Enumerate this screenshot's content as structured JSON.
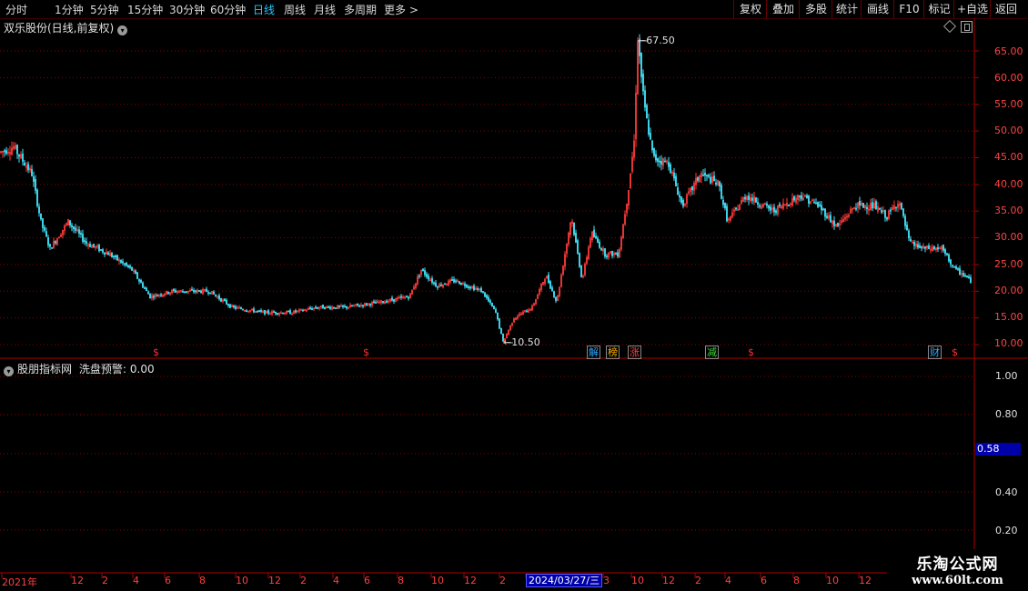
{
  "toolbar": {
    "periods": [
      "分时",
      "1分钟",
      "5分钟",
      "15分钟",
      "30分钟",
      "60分钟",
      "日线",
      "周线",
      "月线",
      "多周期",
      "更多 >"
    ],
    "active_period": "日线",
    "actions": [
      "复权",
      "叠加",
      "多股",
      "统计",
      "画线",
      "F10",
      "标记",
      "+自选",
      "返回"
    ]
  },
  "main_chart": {
    "title": "双乐股份(日线,前复权)",
    "high_label": "67.50",
    "low_label": "10.50",
    "y_axis_labels": [
      "65.00",
      "60.00",
      "55.00",
      "50.00",
      "45.00",
      "40.00",
      "35.00",
      "30.00",
      "25.00",
      "20.00",
      "15.00",
      "10.00"
    ],
    "markers": [
      "$",
      "$",
      "解",
      "榜",
      "涨",
      "减",
      "$",
      "财",
      "$"
    ],
    "colors": {
      "up": "#ff3b3b",
      "down": "#44e8ff",
      "grid": "#8b0000",
      "axis": "#b00000",
      "marker_s": "#ff3030",
      "jie": "#2ea8ff",
      "bang": "#ffb400",
      "zhang": "#ff4444",
      "jian": "#3cdc3c",
      "cai": "#2ea8ff"
    }
  },
  "indicator": {
    "title": "股朋指标网",
    "series_name": "洗盘预警:",
    "series_value": "0.00",
    "y_axis_labels": [
      "1.00",
      "0.80",
      "0.40",
      "0.20"
    ],
    "current_value": "0.58"
  },
  "time_axis": {
    "labels": [
      "2021年",
      "12",
      "2",
      "4",
      "6",
      "8",
      "10",
      "12",
      "2",
      "4",
      "6",
      "8",
      "10",
      "12",
      "2",
      "3",
      "10",
      "12",
      "2",
      "4",
      "6",
      "8",
      "10",
      "12"
    ],
    "cursor_date": "2024/03/27/三"
  },
  "watermark": {
    "line1": "乐淘公式网",
    "line2": "www.60lt.com"
  }
}
